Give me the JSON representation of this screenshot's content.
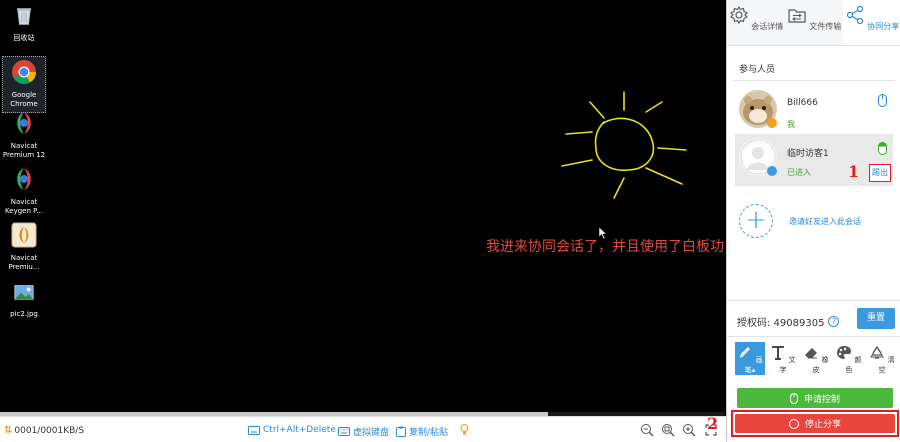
{
  "desktop": {
    "icons": [
      {
        "label": "回收站",
        "icon": "recycle-bin-icon"
      },
      {
        "label": "Google Chrome",
        "icon": "chrome-icon"
      },
      {
        "label": "Navicat Premium 12",
        "icon": "navicat-icon"
      },
      {
        "label": "Navicat Keygen P...",
        "icon": "navicat-keygen-icon"
      },
      {
        "label": "Navicat Premiu...",
        "icon": "navicat-patch-icon"
      },
      {
        "label": "pic2.jpg",
        "icon": "image-file-icon"
      }
    ],
    "whiteboard_text": "我进来协同会话了，并且使用了白板功",
    "whiteboard_color": "#e04a3a",
    "drawing_color": "#e8e020"
  },
  "statusbar": {
    "traffic": "0001/0001KB/S",
    "ctrl_alt_del": "Ctrl+Alt+Delete",
    "virtual_keyboard": "虚拟键盘",
    "copy_paste": "复制/粘贴",
    "annotation_2": "2"
  },
  "panel": {
    "tabs": [
      {
        "label": "会话详情",
        "icon": "gear-icon",
        "active": false
      },
      {
        "label": "文件传输",
        "icon": "file-transfer-icon",
        "active": false
      },
      {
        "label": "协同分享",
        "icon": "share-icon",
        "active": true
      }
    ],
    "participants_title": "参与人员",
    "members": [
      {
        "name": "Bill666",
        "status": "我"
      },
      {
        "name": "临时访客1",
        "status": "已进入",
        "kick_label": "踢出"
      }
    ],
    "annotation_1": "1",
    "invite_text": "邀请好友进入此会话",
    "auth_label": "授权码: 49089305",
    "auth_help": "?",
    "reset_label": "重置",
    "tools": [
      {
        "label": "画笔",
        "icon": "pen-icon",
        "active": true
      },
      {
        "label": "文字",
        "icon": "text-icon",
        "active": false
      },
      {
        "label": "橡皮",
        "icon": "eraser-icon",
        "active": false
      },
      {
        "label": "颜色",
        "icon": "palette-icon",
        "active": false
      },
      {
        "label": "清空",
        "icon": "clear-icon",
        "active": false
      }
    ],
    "request_control": "申请控制",
    "stop_share": "停止分享",
    "accent_color": "#3a9ae0",
    "green_color": "#4cb83c",
    "red_color": "#e8463c"
  }
}
